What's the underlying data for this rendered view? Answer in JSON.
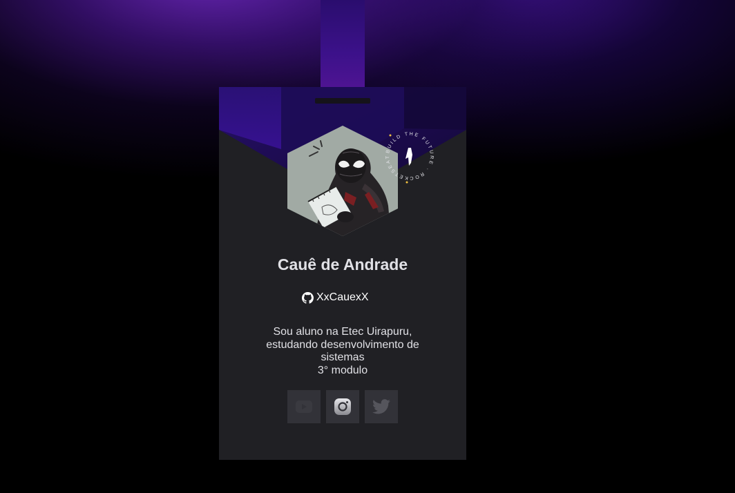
{
  "profile": {
    "name": "Cauê de Andrade",
    "github_username": "XxCauexX",
    "bio_lines": [
      "Sou aluno na Etec Uirapuru,",
      "estudando desenvolvimento de",
      "sistemas",
      "3° modulo"
    ],
    "avatar_icon": "spider-man-avatar-icon"
  },
  "seal": {
    "text": "BUILD THE FUTURE · ROCKETSEAT ·"
  },
  "socials": [
    {
      "icon": "youtube-icon"
    },
    {
      "icon": "instagram-icon"
    },
    {
      "icon": "twitter-icon"
    }
  ],
  "colors": {
    "card_bg": "#202024",
    "social_bg": "#323238",
    "lanyard": "#3c118a",
    "accent_purple": "#4a1aa0",
    "text": "#e1e1e6"
  }
}
